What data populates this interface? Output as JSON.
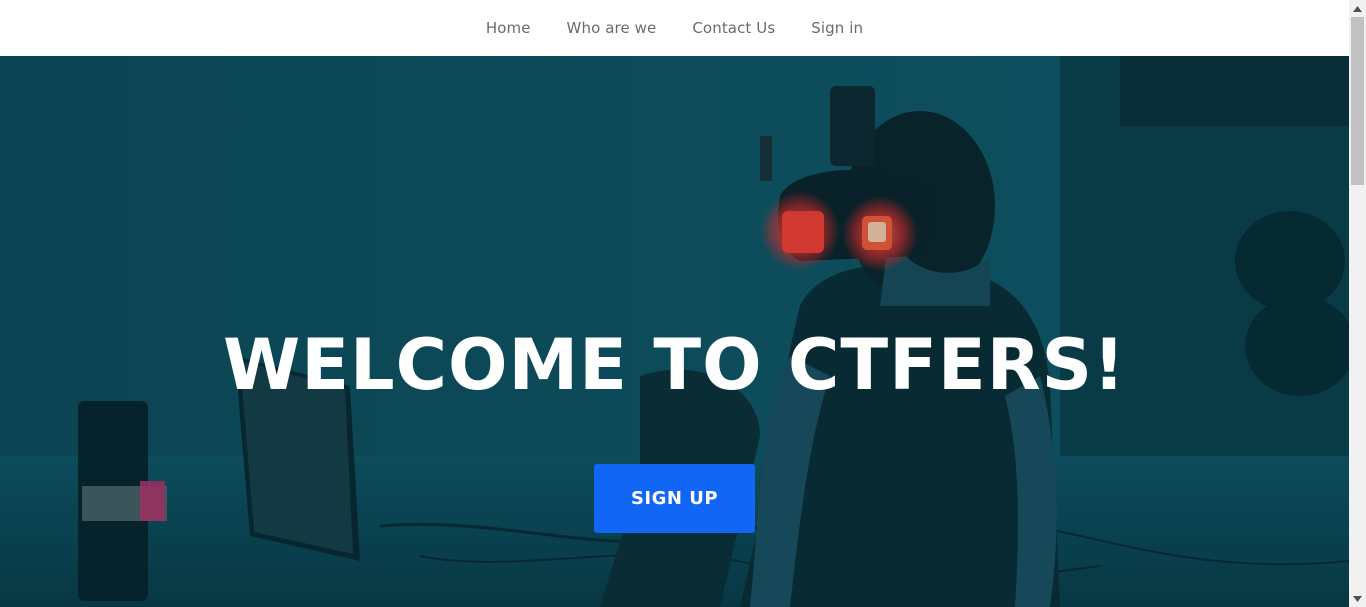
{
  "nav": {
    "items": [
      {
        "label": "Home"
      },
      {
        "label": "Who are we"
      },
      {
        "label": "Contact Us"
      },
      {
        "label": "Sign in"
      }
    ]
  },
  "hero": {
    "title": "WELCOME TO CTFERS!",
    "signup_label": "SIGN UP",
    "background_image": "person-with-vr-headset-cyberpunk-room",
    "overlay_color": "#0f4d5c",
    "accent_light_color": "#ff3b2f"
  },
  "colors": {
    "nav_text": "#6b6b6b",
    "button_bg": "#1166f5",
    "title_text": "#ffffff"
  },
  "scrollbar": {
    "up_icon": "triangle-up-icon",
    "down_icon": "triangle-down-icon"
  }
}
